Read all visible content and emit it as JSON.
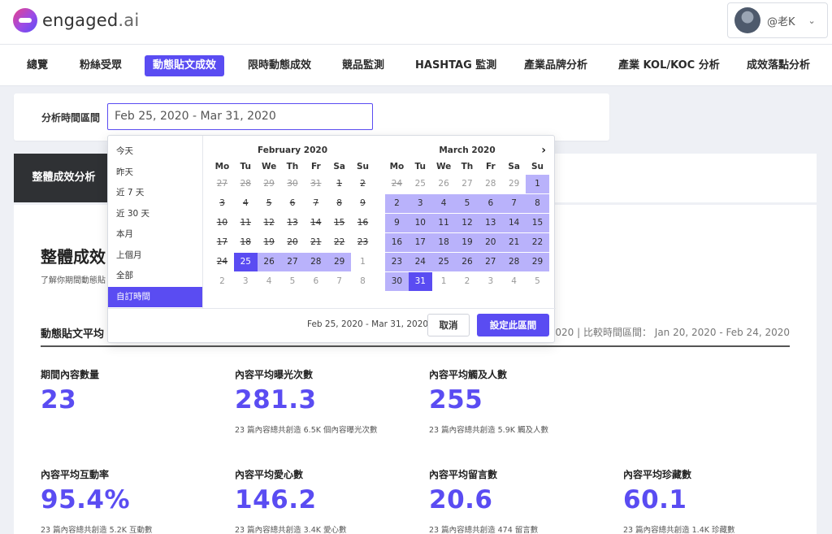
{
  "brand": {
    "name": "engaged",
    "suffix": ".ai",
    "accent": "#5a4cf2"
  },
  "user": {
    "name": "@老K"
  },
  "nav": [
    {
      "label": "總覽",
      "active": false
    },
    {
      "label": "粉絲受眾",
      "active": false
    },
    {
      "label": "動態貼文成效",
      "active": true
    },
    {
      "label": "限時動態成效",
      "active": false
    },
    {
      "label": "競品監測",
      "active": false
    },
    {
      "label": "HASHTAG 監測",
      "active": false
    },
    {
      "label": "產業品牌分析",
      "active": false
    },
    {
      "label": "產業 KOL/KOC 分析",
      "active": false
    },
    {
      "label": "成效落點分析",
      "active": false
    }
  ],
  "time_filter": {
    "label": "分析時間區間",
    "value": "Feb 25, 2020 - Mar 31, 2020"
  },
  "tabs": {
    "active_label": "整體成效分析"
  },
  "section": {
    "title": "整體成效",
    "subtitle": "了解你期間動態貼",
    "sub_title": "動態貼文平均",
    "range_note": "2020 | 比較時間區間： Jan 20, 2020 - Feb 24, 2020"
  },
  "metrics": [
    {
      "label": "期間內容數量",
      "value": "23",
      "note": ""
    },
    {
      "label": "內容平均曝光次數",
      "value": "281.3",
      "note": "23 篇內容總共創造 6.5K 個內容曝光次數"
    },
    {
      "label": "內容平均觸及人數",
      "value": "255",
      "note": "23 篇內容總共創造 5.9K 觸及人數"
    },
    {
      "label": "內容平均互動率",
      "value": "95.4%",
      "note": "23 篇內容總共創造 5.2K 互動數"
    },
    {
      "label": "內容平均愛心數",
      "value": "146.2",
      "note": "23 篇內容總共創造 3.4K 愛心數"
    },
    {
      "label": "內容平均留言數",
      "value": "20.6",
      "note": "23 篇內容總共創造 474 留言數"
    },
    {
      "label": "內容平均珍藏數",
      "value": "60.1",
      "note": "23 篇內容總共創造 1.4K 珍藏數"
    }
  ],
  "picker": {
    "ranges": [
      {
        "label": "今天",
        "active": false
      },
      {
        "label": "昨天",
        "active": false
      },
      {
        "label": "近 7 天",
        "active": false
      },
      {
        "label": "近 30 天",
        "active": false
      },
      {
        "label": "本月",
        "active": false
      },
      {
        "label": "上個月",
        "active": false
      },
      {
        "label": "全部",
        "active": false
      },
      {
        "label": "自訂時間",
        "active": true
      }
    ],
    "weekdays": [
      "Mo",
      "Tu",
      "We",
      "Th",
      "Fr",
      "Sa",
      "Su"
    ],
    "months": [
      {
        "title": "February 2020",
        "days": [
          {
            "d": "27",
            "off": true,
            "strike": true
          },
          {
            "d": "28",
            "off": true,
            "strike": true
          },
          {
            "d": "29",
            "off": true,
            "strike": true
          },
          {
            "d": "30",
            "off": true,
            "strike": true
          },
          {
            "d": "31",
            "off": true,
            "strike": true
          },
          {
            "d": "1",
            "strike": true
          },
          {
            "d": "2",
            "strike": true
          },
          {
            "d": "3",
            "strike": true
          },
          {
            "d": "4",
            "strike": true
          },
          {
            "d": "5",
            "strike": true
          },
          {
            "d": "6",
            "strike": true
          },
          {
            "d": "7",
            "strike": true
          },
          {
            "d": "8",
            "strike": true
          },
          {
            "d": "9",
            "strike": true
          },
          {
            "d": "10",
            "strike": true
          },
          {
            "d": "11",
            "strike": true
          },
          {
            "d": "12",
            "strike": true
          },
          {
            "d": "13",
            "strike": true
          },
          {
            "d": "14",
            "strike": true
          },
          {
            "d": "15",
            "strike": true
          },
          {
            "d": "16",
            "strike": true
          },
          {
            "d": "17",
            "strike": true
          },
          {
            "d": "18",
            "strike": true
          },
          {
            "d": "19",
            "strike": true
          },
          {
            "d": "20",
            "strike": true
          },
          {
            "d": "21",
            "strike": true
          },
          {
            "d": "22",
            "strike": true
          },
          {
            "d": "23",
            "strike": true
          },
          {
            "d": "24",
            "strike": true
          },
          {
            "d": "25",
            "endpoint": true
          },
          {
            "d": "26",
            "inrange": true
          },
          {
            "d": "27",
            "inrange": true
          },
          {
            "d": "28",
            "inrange": true
          },
          {
            "d": "29",
            "inrange": true
          },
          {
            "d": "1",
            "off": true
          },
          {
            "d": "2",
            "off": true
          },
          {
            "d": "3",
            "off": true
          },
          {
            "d": "4",
            "off": true
          },
          {
            "d": "5",
            "off": true
          },
          {
            "d": "6",
            "off": true
          },
          {
            "d": "7",
            "off": true
          },
          {
            "d": "8",
            "off": true
          }
        ]
      },
      {
        "title": "March 2020",
        "days": [
          {
            "d": "24",
            "off": true,
            "strike": true
          },
          {
            "d": "25",
            "off": true
          },
          {
            "d": "26",
            "off": true
          },
          {
            "d": "27",
            "off": true
          },
          {
            "d": "28",
            "off": true
          },
          {
            "d": "29",
            "off": true
          },
          {
            "d": "1",
            "inrange": true
          },
          {
            "d": "2",
            "inrange": true
          },
          {
            "d": "3",
            "inrange": true
          },
          {
            "d": "4",
            "inrange": true
          },
          {
            "d": "5",
            "inrange": true
          },
          {
            "d": "6",
            "inrange": true
          },
          {
            "d": "7",
            "inrange": true
          },
          {
            "d": "8",
            "inrange": true
          },
          {
            "d": "9",
            "inrange": true
          },
          {
            "d": "10",
            "inrange": true
          },
          {
            "d": "11",
            "inrange": true
          },
          {
            "d": "12",
            "inrange": true
          },
          {
            "d": "13",
            "inrange": true
          },
          {
            "d": "14",
            "inrange": true
          },
          {
            "d": "15",
            "inrange": true
          },
          {
            "d": "16",
            "inrange": true
          },
          {
            "d": "17",
            "inrange": true
          },
          {
            "d": "18",
            "inrange": true
          },
          {
            "d": "19",
            "inrange": true
          },
          {
            "d": "20",
            "inrange": true
          },
          {
            "d": "21",
            "inrange": true
          },
          {
            "d": "22",
            "inrange": true
          },
          {
            "d": "23",
            "inrange": true
          },
          {
            "d": "24",
            "inrange": true
          },
          {
            "d": "25",
            "inrange": true
          },
          {
            "d": "26",
            "inrange": true
          },
          {
            "d": "27",
            "inrange": true
          },
          {
            "d": "28",
            "inrange": true
          },
          {
            "d": "29",
            "inrange": true
          },
          {
            "d": "30",
            "inrange": true
          },
          {
            "d": "31",
            "endpoint": true
          },
          {
            "d": "1",
            "off": true
          },
          {
            "d": "2",
            "off": true
          },
          {
            "d": "3",
            "off": true
          },
          {
            "d": "4",
            "off": true
          },
          {
            "d": "5",
            "off": true
          }
        ]
      }
    ],
    "footer_range": "Feb 25, 2020 - Mar 31, 2020",
    "cancel_label": "取消",
    "apply_label": "設定此區間"
  }
}
